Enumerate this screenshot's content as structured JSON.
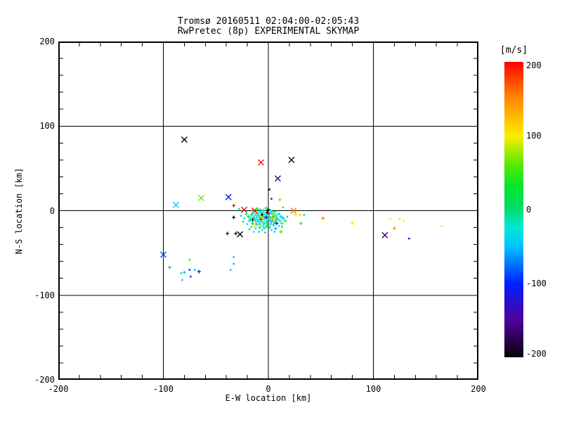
{
  "header": {
    "title_line1": "Tromsø 20160511 02:04:00-02:05:43",
    "title_line2": "RwPretec (8p) EXPERIMENTAL SKYMAP"
  },
  "chart_data": {
    "type": "scatter",
    "title": "Tromsø 20160511 02:04:00-02:05:43",
    "subtitle": "RwPretec (8p) EXPERIMENTAL SKYMAP",
    "xlabel": "E-W location [km]",
    "ylabel": "N-S location [km]",
    "xlim": [
      -200,
      200
    ],
    "ylim": [
      -200,
      200
    ],
    "x_major_ticks": [
      -200,
      -100,
      0,
      100,
      200
    ],
    "y_major_ticks": [
      -200,
      -100,
      0,
      100,
      200
    ],
    "minor_tick_step": 20,
    "grid": true,
    "grid_lines_x": [
      -100,
      0,
      100
    ],
    "grid_lines_y": [
      -100,
      0,
      100
    ],
    "colorbar": {
      "label": "[m/s]",
      "min": -200,
      "max": 200,
      "ticks": [
        200,
        100,
        0,
        -100,
        -200
      ],
      "stops": [
        [
          -200,
          "#0a0008"
        ],
        [
          -150,
          "#50009b"
        ],
        [
          -100,
          "#0020ff"
        ],
        [
          -50,
          "#00c3ff"
        ],
        [
          -25,
          "#00e8d8"
        ],
        [
          0,
          "#00dc6e"
        ],
        [
          30,
          "#00e62e"
        ],
        [
          60,
          "#52ea00"
        ],
        [
          100,
          "#ffec00"
        ],
        [
          150,
          "#ff8a00"
        ],
        [
          200,
          "#ff0000"
        ]
      ]
    },
    "points_format": [
      "x_km",
      "y_km",
      "velocity_mps",
      "marker"
    ],
    "points": [
      [
        -80,
        84,
        -200,
        "x"
      ],
      [
        -7,
        57,
        195,
        "x"
      ],
      [
        22,
        60,
        -195,
        "x"
      ],
      [
        9,
        38,
        -160,
        "x"
      ],
      [
        -64,
        15,
        65,
        "x"
      ],
      [
        -38,
        16,
        -105,
        "x"
      ],
      [
        -88,
        7,
        -45,
        "x"
      ],
      [
        24,
        0,
        155,
        "x"
      ],
      [
        -100,
        -52,
        -90,
        "x"
      ],
      [
        111,
        -29,
        -160,
        "x"
      ],
      [
        -27,
        -28,
        -200,
        "x"
      ],
      [
        -23,
        1,
        200,
        "x"
      ],
      [
        -13,
        0,
        200,
        "x"
      ],
      [
        80,
        -15,
        100,
        "+"
      ],
      [
        116,
        -10,
        100,
        "."
      ],
      [
        125,
        -10,
        95,
        "."
      ],
      [
        129,
        -12,
        100,
        "."
      ],
      [
        120,
        -21,
        145,
        "+"
      ],
      [
        134,
        -33,
        -110,
        "."
      ],
      [
        165,
        -18,
        100,
        "."
      ],
      [
        -94,
        -67,
        -40,
        "+"
      ],
      [
        -75,
        -58,
        45,
        "."
      ],
      [
        -83,
        -74,
        -45,
        "."
      ],
      [
        -80,
        -73,
        -40,
        "+"
      ],
      [
        -75,
        -70,
        -95,
        "."
      ],
      [
        -70,
        -70,
        -50,
        "."
      ],
      [
        -66,
        -72,
        -105,
        "+"
      ],
      [
        -74,
        -78,
        -90,
        "."
      ],
      [
        -82,
        -82,
        -45,
        "."
      ],
      [
        -33,
        -55,
        -50,
        "."
      ],
      [
        -33,
        -63,
        -50,
        "."
      ],
      [
        -36,
        -70,
        -50,
        "."
      ],
      [
        -39,
        -27,
        -170,
        "+"
      ],
      [
        -31,
        -27,
        -185,
        "+"
      ],
      [
        -13,
        -18,
        110,
        "+"
      ],
      [
        -4,
        -21,
        -60,
        "."
      ],
      [
        7,
        -21,
        -55,
        "+"
      ],
      [
        12,
        -25,
        55,
        "+"
      ],
      [
        1,
        25,
        -200,
        "."
      ],
      [
        3,
        14,
        -120,
        "."
      ],
      [
        11,
        13,
        70,
        "+"
      ],
      [
        14,
        4,
        50,
        "."
      ],
      [
        26,
        -5,
        100,
        "+"
      ],
      [
        30,
        -5,
        105,
        "+"
      ],
      [
        34,
        -5,
        -50,
        "."
      ],
      [
        52,
        -9,
        150,
        "+"
      ],
      [
        31,
        -15,
        60,
        "+"
      ],
      [
        -33,
        6,
        200,
        "+"
      ],
      [
        -28,
        2,
        -45,
        "."
      ],
      [
        -33,
        -8,
        -200,
        "+"
      ],
      [
        -2,
        3,
        -10,
        "+"
      ],
      [
        0,
        1,
        -200,
        "+"
      ],
      [
        2,
        0,
        -40,
        "+"
      ],
      [
        -5,
        0,
        20,
        "+"
      ],
      [
        -8,
        1,
        -35,
        "+"
      ],
      [
        -11,
        2,
        40,
        "+"
      ],
      [
        -1,
        -2,
        -200,
        "+"
      ],
      [
        3,
        -2,
        -30,
        "+"
      ],
      [
        6,
        -1,
        10,
        "+"
      ],
      [
        -4,
        -3,
        -25,
        "+"
      ],
      [
        -7,
        -2,
        -45,
        "+"
      ],
      [
        -10,
        -3,
        30,
        "+"
      ],
      [
        -14,
        -2,
        -15,
        "+"
      ],
      [
        1,
        -4,
        -35,
        "+"
      ],
      [
        4,
        -4,
        55,
        "+"
      ],
      [
        -2,
        -5,
        -10,
        "+"
      ],
      [
        -6,
        -5,
        -200,
        "+"
      ],
      [
        -9,
        -6,
        -30,
        "+"
      ],
      [
        -12,
        -5,
        -50,
        "+"
      ],
      [
        -16,
        -5,
        25,
        "+"
      ],
      [
        7,
        -5,
        -25,
        "+"
      ],
      [
        10,
        -4,
        -45,
        "+"
      ],
      [
        0,
        -7,
        15,
        "+"
      ],
      [
        -3,
        -7,
        -40,
        "+"
      ],
      [
        -5,
        -8,
        -15,
        "+"
      ],
      [
        -8,
        -8,
        45,
        "+"
      ],
      [
        -11,
        -8,
        -30,
        "+"
      ],
      [
        -14,
        -8,
        -55,
        "+"
      ],
      [
        2,
        -8,
        -35,
        "+"
      ],
      [
        5,
        -7,
        30,
        "+"
      ],
      [
        8,
        -8,
        -20,
        "+"
      ],
      [
        12,
        -7,
        -40,
        "+"
      ],
      [
        -1,
        -10,
        -25,
        "+"
      ],
      [
        -4,
        -10,
        10,
        "+"
      ],
      [
        -7,
        -10,
        -200,
        "+"
      ],
      [
        -10,
        -11,
        -35,
        "+"
      ],
      [
        -13,
        -10,
        50,
        "+"
      ],
      [
        -17,
        -9,
        -20,
        "+"
      ],
      [
        1,
        -11,
        -45,
        "+"
      ],
      [
        4,
        -11,
        -10,
        "+"
      ],
      [
        7,
        -11,
        35,
        "+"
      ],
      [
        -2,
        -13,
        -30,
        "+"
      ],
      [
        -6,
        -13,
        -15,
        "+"
      ],
      [
        -9,
        -13,
        -45,
        "+"
      ],
      [
        -12,
        -13,
        -25,
        "+"
      ],
      [
        3,
        -13,
        -55,
        "+"
      ],
      [
        6,
        -14,
        20,
        "+"
      ],
      [
        -4,
        -15,
        -35,
        "+"
      ],
      [
        -8,
        -16,
        -10,
        "+"
      ],
      [
        -1,
        -16,
        40,
        "+"
      ],
      [
        2,
        -16,
        -25,
        "+"
      ],
      [
        -11,
        -16,
        -45,
        "+"
      ],
      [
        5,
        -17,
        -15,
        "+"
      ],
      [
        -5,
        -18,
        -30,
        "+"
      ],
      [
        -2,
        -19,
        25,
        "+"
      ],
      [
        1,
        -20,
        -40,
        "+"
      ],
      [
        -8,
        -20,
        -20,
        "+"
      ],
      [
        9,
        -10,
        60,
        "+"
      ],
      [
        11,
        -12,
        -30,
        "+"
      ],
      [
        14,
        -9,
        -50,
        "+"
      ],
      [
        -19,
        -7,
        35,
        "+"
      ],
      [
        -21,
        -4,
        -25,
        "+"
      ],
      [
        -18,
        -12,
        -40,
        "+"
      ],
      [
        -15,
        -15,
        15,
        "+"
      ],
      [
        13,
        -15,
        -35,
        "+"
      ],
      [
        16,
        -12,
        45,
        "+"
      ],
      [
        -23,
        -9,
        -15,
        "."
      ],
      [
        -20,
        -16,
        -30,
        "."
      ],
      [
        18,
        -7,
        -45,
        "."
      ],
      [
        -24,
        -13,
        20,
        "."
      ],
      [
        -26,
        -6,
        -35,
        "."
      ],
      [
        -16,
        -19,
        -25,
        "."
      ],
      [
        10,
        -18,
        -15,
        "."
      ],
      [
        13,
        -19,
        30,
        "."
      ],
      [
        -12,
        -21,
        -45,
        "."
      ],
      [
        -6,
        -23,
        -20,
        "."
      ],
      [
        -18,
        -22,
        40,
        "."
      ],
      [
        3,
        -23,
        -30,
        "."
      ],
      [
        -9,
        -25,
        -40,
        "."
      ],
      [
        -3,
        -26,
        15,
        "."
      ],
      [
        -14,
        -25,
        -25,
        "."
      ],
      [
        6,
        -25,
        -35,
        "."
      ],
      [
        0,
        -3,
        200,
        "+"
      ],
      [
        -6,
        -9,
        100,
        "+"
      ],
      [
        4,
        -9,
        150,
        "+"
      ],
      [
        -10,
        -18,
        100,
        "+"
      ],
      [
        -2,
        -8,
        -120,
        "+"
      ],
      [
        8,
        -15,
        -110,
        "+"
      ],
      [
        -15,
        -11,
        -130,
        "+"
      ]
    ]
  }
}
